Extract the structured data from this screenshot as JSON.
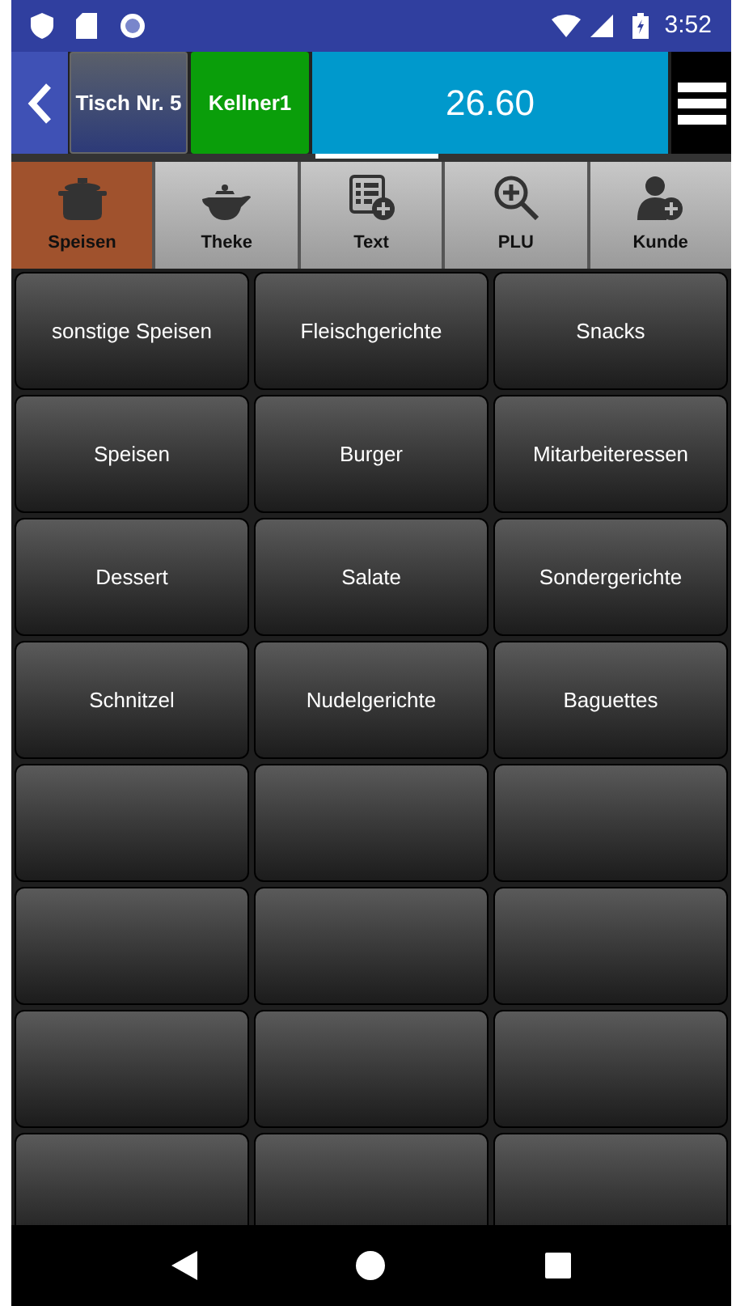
{
  "status_bar": {
    "time": "3:52"
  },
  "header": {
    "table": "Tisch Nr. 5",
    "waiter": "Kellner1",
    "total": "26.60"
  },
  "tabs": [
    {
      "label": "Speisen",
      "selected": true
    },
    {
      "label": "Theke",
      "selected": false
    },
    {
      "label": "Text",
      "selected": false
    },
    {
      "label": "PLU",
      "selected": false
    },
    {
      "label": "Kunde",
      "selected": false
    }
  ],
  "categories": [
    "sonstige Speisen",
    "Fleischgerichte",
    "Snacks",
    "Speisen",
    "Burger",
    "Mitarbeiteressen",
    "Dessert",
    "Salate",
    "Sondergerichte",
    "Schnitzel",
    "Nudelgerichte",
    "Baguettes"
  ]
}
